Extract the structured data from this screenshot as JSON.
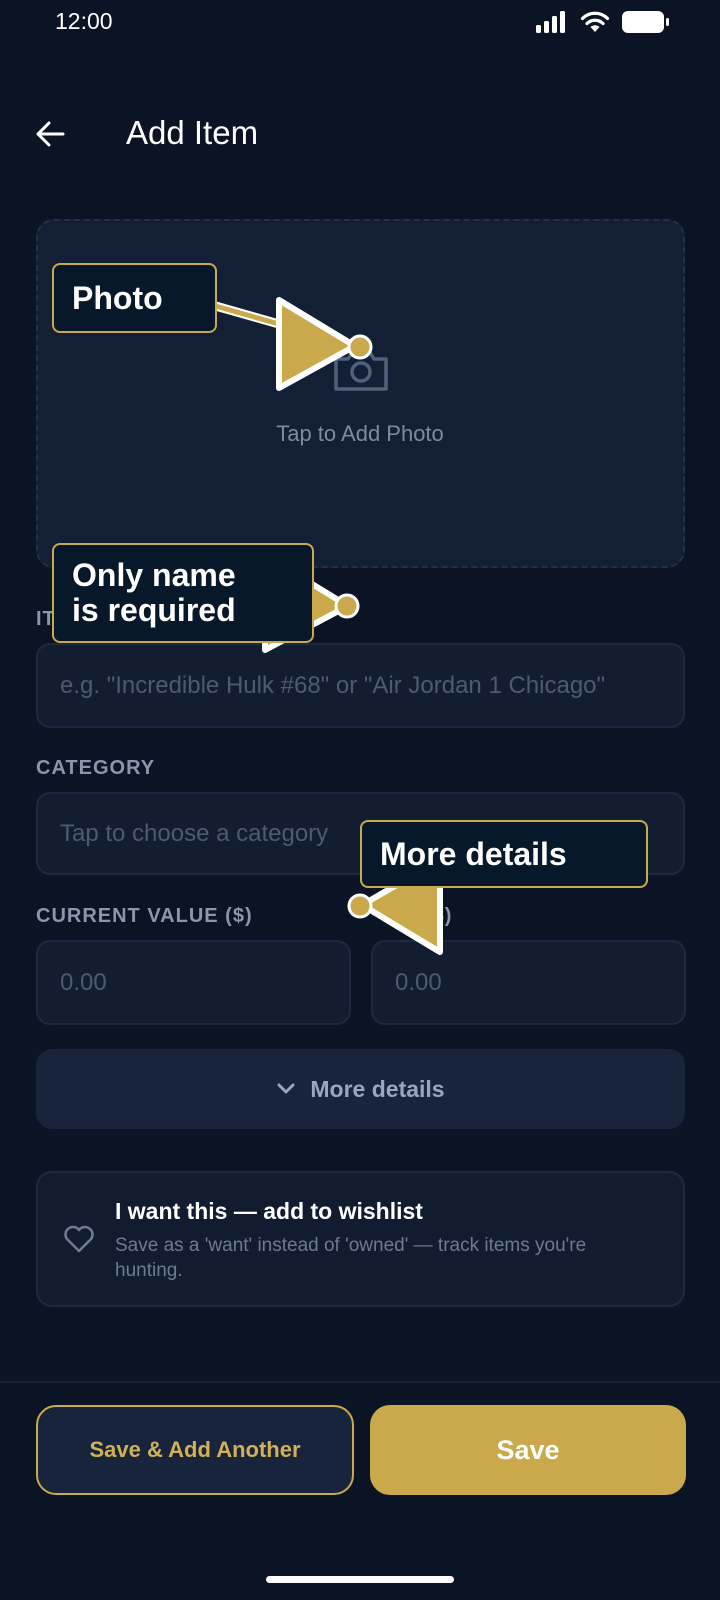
{
  "status": {
    "time": "12:00"
  },
  "header": {
    "title": "Add Item",
    "back_icon": "arrow-left-icon"
  },
  "photo": {
    "label": "Tap to Add Photo",
    "icon": "camera-icon"
  },
  "fields": {
    "name_label": "IT",
    "name_placeholder": "e.g. \"Incredible Hulk #68\" or \"Air Jordan 1 Chicago\"",
    "category_label": "CATEGORY",
    "category_placeholder": "Tap to choose a category",
    "current_value_label": "CURRENT VALUE ($)",
    "current_value_placeholder": "0.00",
    "second_value_label": "($)",
    "second_value_placeholder": "0.00"
  },
  "more_details": {
    "label": "More details",
    "icon": "chevron-down-icon"
  },
  "wishlist": {
    "title": "I want this — add to wishlist",
    "description": "Save as a 'want' instead of 'owned' — track items you're hunting.",
    "icon": "heart-icon"
  },
  "actions": {
    "secondary": "Save & Add Another",
    "primary": "Save"
  },
  "annotations": {
    "photo": "Photo",
    "name_line1": "Only name",
    "name_line2": "is required",
    "more": "More details"
  },
  "colors": {
    "background": "#0b1425",
    "accent": "#c9a94c",
    "card": "#121d32"
  }
}
